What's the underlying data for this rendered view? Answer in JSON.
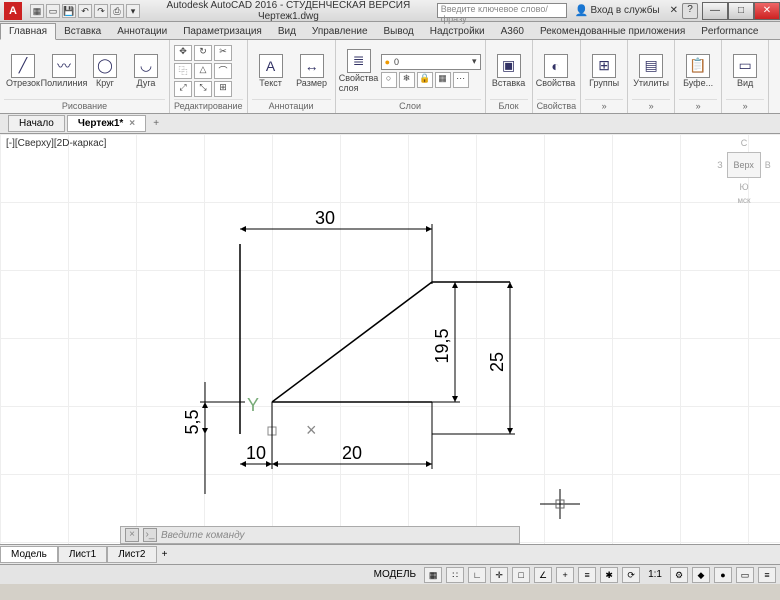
{
  "title": "Autodesk AutoCAD 2016 - СТУДЕНЧЕСКАЯ ВЕРСИЯ    Чертеж1.dwg",
  "search_placeholder": "Введите ключевое слово/фразу",
  "login_label": "Вход в службы",
  "tabs": [
    "Главная",
    "Вставка",
    "Аннотации",
    "Параметризация",
    "Вид",
    "Управление",
    "Вывод",
    "Надстройки",
    "A360",
    "Рекомендованные приложения",
    "Performance"
  ],
  "ribbon": {
    "draw": {
      "label": "Рисование",
      "tools": {
        "line": "Отрезок",
        "polyline": "Полилиния",
        "circle": "Круг",
        "arc": "Дуга"
      }
    },
    "modify": {
      "label": "Редактирование"
    },
    "annot": {
      "label": "Аннотации",
      "text": "Текст",
      "dim": "Размер"
    },
    "layers": {
      "label": "Слои",
      "props": "Свойства слоя",
      "current": "0"
    },
    "block": {
      "label": "Блок",
      "insert": "Вставка"
    },
    "props": {
      "label": "Свойства"
    },
    "groups": {
      "label": "Группы"
    },
    "utils": {
      "label": "Утилиты"
    },
    "clip": {
      "label": "Буфе..."
    },
    "view": {
      "label": "Вид"
    }
  },
  "doc_tabs": {
    "start": "Начало",
    "current": "Чертеж1*"
  },
  "view_label": "[-][Сверху][2D-каркас]",
  "viewcube": {
    "top": "С",
    "front": "Верх",
    "south": "Ю",
    "e": "З",
    "w": "В",
    "wcs": "мск"
  },
  "dimensions": {
    "d30": "30",
    "d10": "10",
    "d20": "20",
    "d19_5": "19,5",
    "d25": "25",
    "d5_5": "5,5"
  },
  "cmd_placeholder": "Введите команду",
  "model_tabs": {
    "model": "Модель",
    "l1": "Лист1",
    "l2": "Лист2"
  },
  "status": {
    "model": "МОДЕЛЬ",
    "scale": "1:1"
  }
}
